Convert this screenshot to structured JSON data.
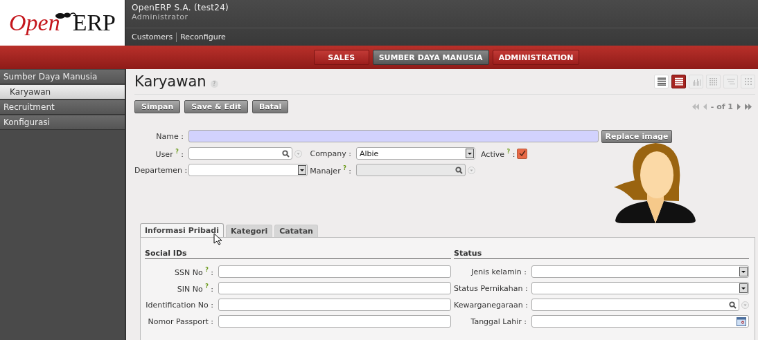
{
  "logo": {
    "open": "Open",
    "erp": "ERP"
  },
  "header": {
    "company": "OpenERP S.A. (test24)",
    "user": "Administrator",
    "links": [
      "Customers",
      "Reconfigure"
    ]
  },
  "menu": [
    {
      "label": "SALES",
      "selected": false
    },
    {
      "label": "SUMBER DAYA MANUSIA",
      "selected": true
    },
    {
      "label": "ADMINISTRATION",
      "selected": false
    }
  ],
  "sidebar": [
    {
      "label": "Sumber Daya Manusia",
      "selected": false,
      "children": [
        {
          "label": "Karyawan",
          "selected": true
        }
      ]
    },
    {
      "label": "Recruitment",
      "selected": false
    },
    {
      "label": "Konfigurasi",
      "selected": false
    }
  ],
  "page": {
    "title": "Karyawan",
    "help": "?",
    "buttons": [
      "Simpan",
      "Save & Edit",
      "Batal"
    ],
    "views": [
      {
        "kind": "list",
        "selected": false
      },
      {
        "kind": "form",
        "selected": true
      },
      {
        "kind": "graph",
        "selected": false
      },
      {
        "kind": "calendar",
        "selected": false
      },
      {
        "kind": "gantt",
        "selected": false
      },
      {
        "kind": "kanban",
        "selected": false
      }
    ],
    "pager": "- of 1"
  },
  "form": {
    "rows": [
      [
        {
          "kind": "text",
          "label": "Name :",
          "required": true
        },
        {
          "kind": "button",
          "label": "Replace image"
        }
      ],
      [
        {
          "kind": "search",
          "label": "User $^{?}$ :"
        },
        {
          "kind": "select",
          "label": "Company :",
          "value": "Albie"
        },
        {
          "kind": "checkbox",
          "label": "Active $^{?}$ :",
          "checked": true
        }
      ],
      [
        {
          "kind": "select",
          "label": "Departemen :"
        },
        {
          "kind": "search",
          "label": "Manajer $^{?}$ :",
          "disabled": true
        }
      ]
    ]
  },
  "tabs": [
    {
      "label": "Informasi Pribadi",
      "selected": true
    },
    {
      "label": "Kategori",
      "selected": false
    },
    {
      "label": "Catatan",
      "selected": false
    }
  ],
  "sections": [
    {
      "title": "Social IDs",
      "fields": [
        {
          "kind": "text",
          "label": "SSN No $^{?}$ :"
        },
        {
          "kind": "text",
          "label": "SIN No $^{?}$ :"
        },
        {
          "kind": "text",
          "label": "Identification No :"
        },
        {
          "kind": "text",
          "label": "Nomor Passport :"
        }
      ]
    },
    {
      "title": "Status",
      "fields": [
        {
          "kind": "select",
          "label": "Jenis kelamin :"
        },
        {
          "kind": "select",
          "label": "Status Pernikahan :"
        },
        {
          "kind": "search",
          "label": "Kewarganegaraan :"
        },
        {
          "kind": "date",
          "label": "Tanggal Lahir :"
        }
      ]
    }
  ]
}
